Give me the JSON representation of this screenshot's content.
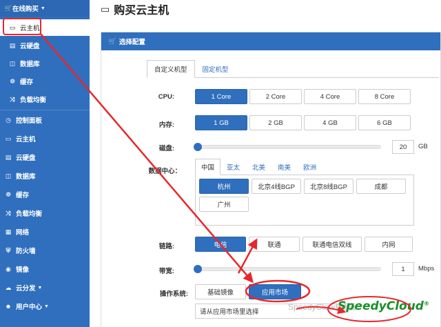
{
  "sidebar": {
    "top": "在线购买",
    "sub_items": [
      {
        "label": "云主机",
        "icon": "monitor-icon"
      },
      {
        "label": "云硬盘",
        "icon": "hdd-icon"
      },
      {
        "label": "数据库",
        "icon": "database-icon"
      },
      {
        "label": "缓存",
        "icon": "cache-icon"
      },
      {
        "label": "负载均衡",
        "icon": "shuffle-icon"
      }
    ],
    "main_items": [
      {
        "label": "控制面板",
        "icon": "dashboard-icon"
      },
      {
        "label": "云主机",
        "icon": "monitor-icon"
      },
      {
        "label": "云硬盘",
        "icon": "hdd-icon"
      },
      {
        "label": "数据库",
        "icon": "database-icon"
      },
      {
        "label": "缓存",
        "icon": "cache-icon"
      },
      {
        "label": "负载均衡",
        "icon": "shuffle-icon"
      },
      {
        "label": "网络",
        "icon": "network-icon"
      },
      {
        "label": "防火墙",
        "icon": "firewall-icon"
      },
      {
        "label": "镜像",
        "icon": "image-icon"
      },
      {
        "label": "云分发",
        "icon": "cloud-icon"
      },
      {
        "label": "用户中心",
        "icon": "user-icon"
      }
    ]
  },
  "page": {
    "title": "购买云主机"
  },
  "panel": {
    "title": "选择配置"
  },
  "tabs": [
    "自定义机型",
    "固定机型"
  ],
  "cpu": {
    "label": "CPU:",
    "options": [
      "1 Core",
      "2 Core",
      "4 Core",
      "8 Core"
    ],
    "selected": 0
  },
  "memory": {
    "label": "内存:",
    "options": [
      "1 GB",
      "2 GB",
      "4 GB",
      "6 GB"
    ],
    "selected": 0
  },
  "disk": {
    "label": "磁盘:",
    "value": "20",
    "unit": "GB"
  },
  "datacenter": {
    "label": "数据中心：",
    "regions": [
      "中国",
      "亚太",
      "北美",
      "南美",
      "欧洲"
    ],
    "region_selected": 0,
    "zones": [
      "杭州",
      "北京4线BGP",
      "北京8线BGP",
      "成都",
      "广州"
    ],
    "zone_selected": 0
  },
  "network": {
    "label": "链路:",
    "options": [
      "电信",
      "联通",
      "联通电信双线",
      "内网"
    ],
    "selected": 0
  },
  "bandwidth": {
    "label": "带宽:",
    "value": "1",
    "unit": "Mbps"
  },
  "os": {
    "label": "操作系统:",
    "options": [
      "基础镜像",
      "应用市场"
    ],
    "selected": 1,
    "placeholder": "请从应用市场里选择"
  },
  "brand": {
    "watermark": "SpeedyCloud 速云",
    "logo": "SpeedyCloud",
    "accent": "#2f6fbd",
    "annotation": "#e8262b"
  }
}
